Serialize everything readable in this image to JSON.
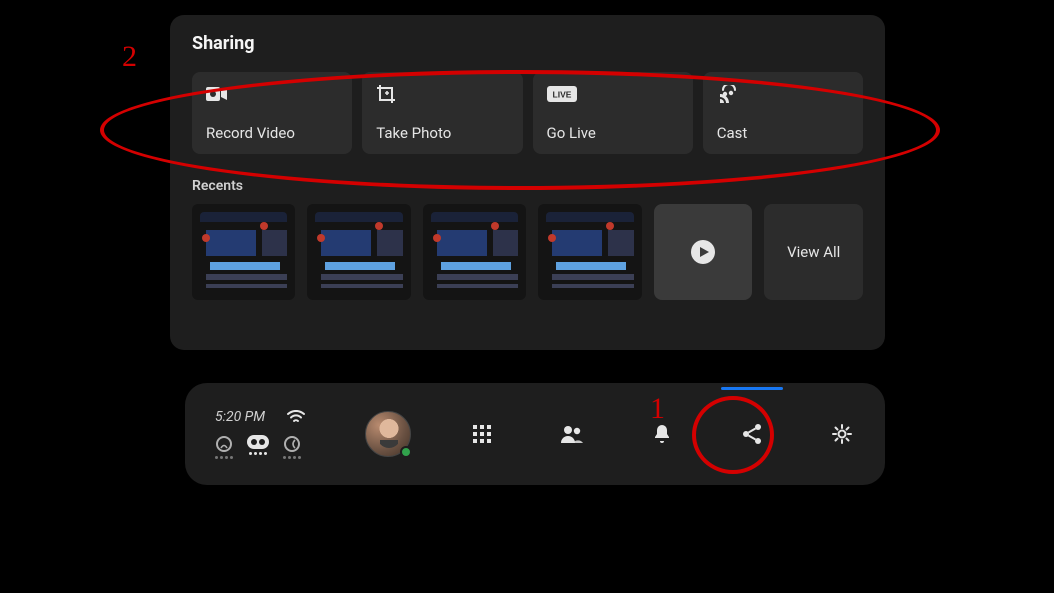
{
  "sharing": {
    "title": "Sharing",
    "tiles": [
      {
        "label": "Record Video"
      },
      {
        "label": "Take Photo"
      },
      {
        "label": "Go Live"
      },
      {
        "label": "Cast"
      }
    ]
  },
  "recents": {
    "title": "Recents",
    "viewAll": "View All"
  },
  "dock": {
    "time": "5:20 PM"
  },
  "annotations": {
    "num1": "1",
    "num2": "2"
  }
}
